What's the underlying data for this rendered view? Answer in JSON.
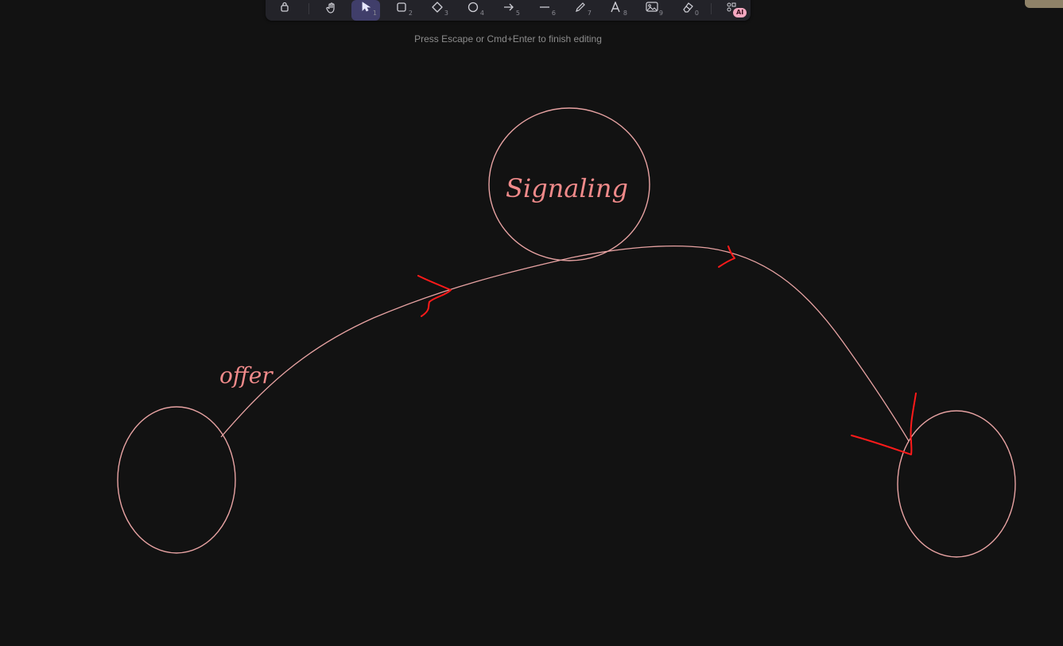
{
  "toolbar": {
    "tools": [
      {
        "name": "lock",
        "key": ""
      },
      {
        "name": "hand",
        "key": ""
      },
      {
        "name": "selection",
        "key": "1"
      },
      {
        "name": "rectangle",
        "key": "2"
      },
      {
        "name": "diamond",
        "key": "3"
      },
      {
        "name": "ellipse",
        "key": "4"
      },
      {
        "name": "arrow",
        "key": "5"
      },
      {
        "name": "line",
        "key": "6"
      },
      {
        "name": "draw",
        "key": "7"
      },
      {
        "name": "text",
        "key": "8"
      },
      {
        "name": "image",
        "key": "9"
      },
      {
        "name": "eraser",
        "key": "0"
      }
    ],
    "ai_badge": "AI",
    "active_tool": "selection"
  },
  "hint": "Press Escape or Cmd+Enter to finish editing",
  "canvas": {
    "labels": {
      "signaling": "Signaling",
      "offer": "offer"
    },
    "colors": {
      "background": "#121212",
      "stroke": "#e8a3a3",
      "label": "#f08a8a",
      "annotation": "#ff1a1a"
    }
  }
}
